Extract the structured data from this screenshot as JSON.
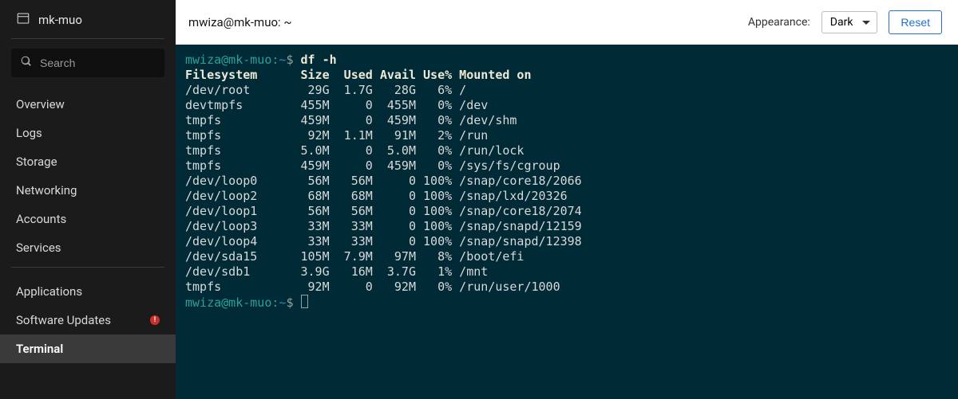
{
  "sidebar": {
    "host": "mk-muo",
    "search_placeholder": "Search",
    "group1": [
      "Overview",
      "Logs",
      "Storage",
      "Networking",
      "Accounts",
      "Services"
    ],
    "group2": [
      {
        "label": "Applications",
        "alert": false
      },
      {
        "label": "Software Updates",
        "alert": true,
        "alert_glyph": "!"
      },
      {
        "label": "Terminal",
        "alert": false,
        "active": true
      }
    ]
  },
  "topbar": {
    "breadcrumb": "mwiza@mk-muo: ~",
    "appearance_label": "Appearance:",
    "appearance_value": "Dark",
    "reset_label": "Reset"
  },
  "terminal": {
    "prompt_user_host": "mwiza@mk-muo:",
    "prompt_path": "~",
    "prompt_dollar": "$",
    "command": "df -h",
    "header": "Filesystem      Size  Used Avail Use% Mounted on",
    "rows": [
      "/dev/root        29G  1.7G   28G   6% /",
      "devtmpfs        455M     0  455M   0% /dev",
      "tmpfs           459M     0  459M   0% /dev/shm",
      "tmpfs            92M  1.1M   91M   2% /run",
      "tmpfs           5.0M     0  5.0M   0% /run/lock",
      "tmpfs           459M     0  459M   0% /sys/fs/cgroup",
      "/dev/loop0       56M   56M     0 100% /snap/core18/2066",
      "/dev/loop2       68M   68M     0 100% /snap/lxd/20326",
      "/dev/loop1       56M   56M     0 100% /snap/core18/2074",
      "/dev/loop3       33M   33M     0 100% /snap/snapd/12159",
      "/dev/loop4       33M   33M     0 100% /snap/snapd/12398",
      "/dev/sda15      105M  7.9M   97M   8% /boot/efi",
      "/dev/sdb1       3.9G   16M  3.7G   1% /mnt",
      "tmpfs            92M     0   92M   0% /run/user/1000"
    ]
  }
}
